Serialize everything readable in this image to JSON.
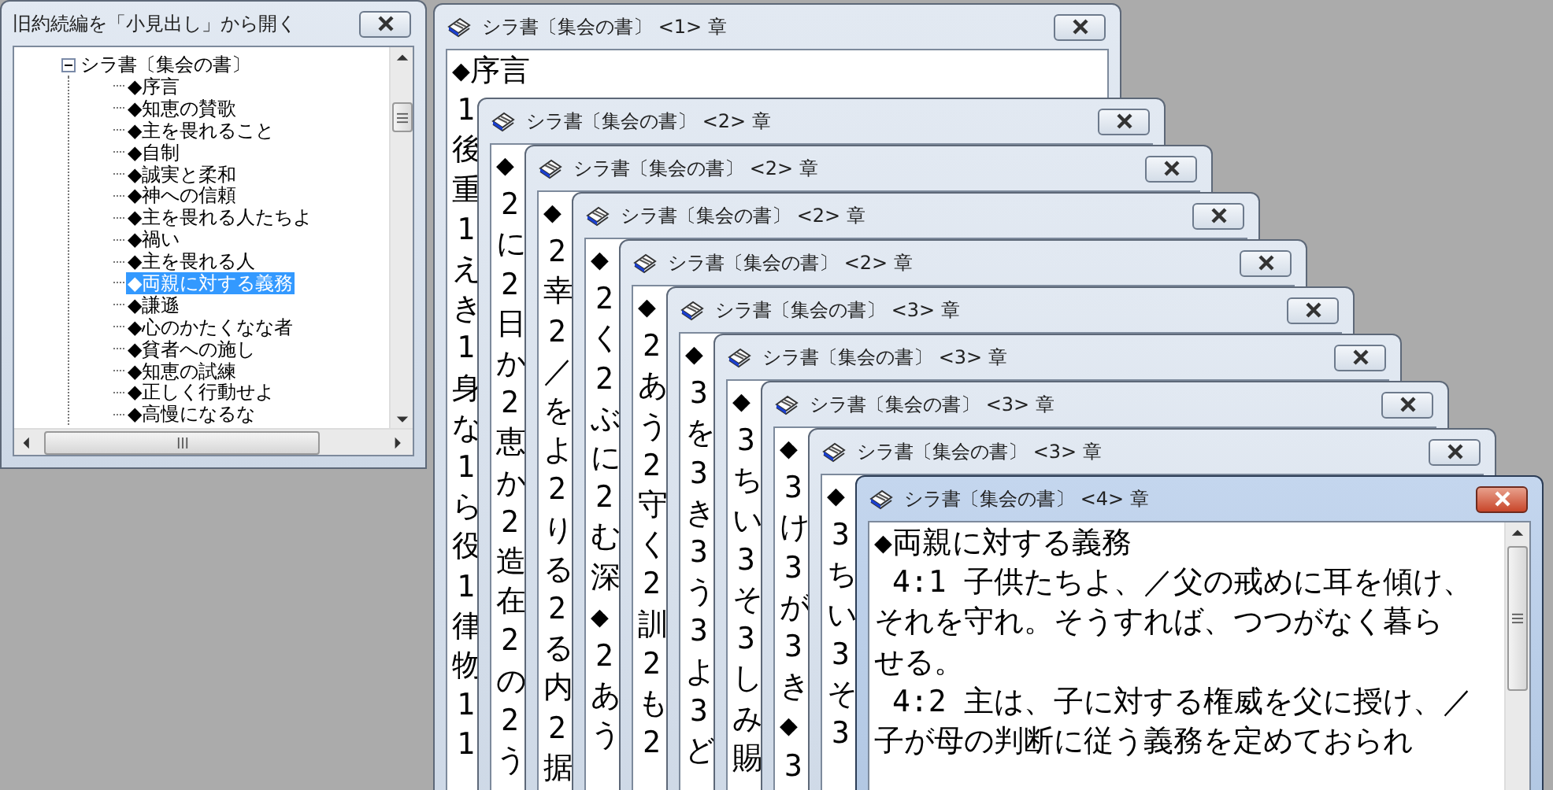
{
  "outline_window": {
    "title": "旧約続編を「小見出し」から開く",
    "active": false,
    "tree": [
      {
        "label": "シラ書〔集会の書〕",
        "expanded": true,
        "selected": false,
        "children": [
          {
            "label": "◆序言",
            "selected": false
          },
          {
            "label": "◆知恵の賛歌",
            "selected": false
          },
          {
            "label": "◆主を畏れること",
            "selected": false
          },
          {
            "label": "◆自制",
            "selected": false
          },
          {
            "label": "◆誠実と柔和",
            "selected": false
          },
          {
            "label": "◆神への信頼",
            "selected": false
          },
          {
            "label": "◆主を畏れる人たちよ",
            "selected": false
          },
          {
            "label": "◆禍い",
            "selected": false
          },
          {
            "label": "◆主を畏れる人",
            "selected": false
          },
          {
            "label": "◆両親に対する義務",
            "selected": true
          },
          {
            "label": "◆謙遜",
            "selected": false
          },
          {
            "label": "◆心のかたくなな者",
            "selected": false
          },
          {
            "label": "◆貧者への施し",
            "selected": false
          },
          {
            "label": "◆知恵の試練",
            "selected": false
          },
          {
            "label": "◆正しく行動せよ",
            "selected": false
          },
          {
            "label": "◆高慢になるな",
            "selected": false
          }
        ]
      }
    ]
  },
  "chapter_windows": [
    {
      "title": "シラ書〔集会の書〕 <1> 章",
      "active": false,
      "lines": [
        {
          "text": "◆序言",
          "kind": "heading"
        },
        {
          "text": "1",
          "kind": "number"
        },
        {
          "text": "後",
          "kind": "text"
        },
        {
          "text": "重",
          "kind": "text"
        },
        {
          "text": "1",
          "kind": "number"
        },
        {
          "text": "え",
          "kind": "text"
        },
        {
          "text": "き",
          "kind": "text"
        },
        {
          "text": "1",
          "kind": "number"
        },
        {
          "text": "身",
          "kind": "text"
        },
        {
          "text": "な",
          "kind": "text"
        },
        {
          "text": "1",
          "kind": "number"
        },
        {
          "text": "ら",
          "kind": "text"
        },
        {
          "text": "役",
          "kind": "text"
        },
        {
          "text": "1",
          "kind": "number"
        },
        {
          "text": "律",
          "kind": "text"
        },
        {
          "text": "物",
          "kind": "text"
        },
        {
          "text": "1",
          "kind": "number"
        },
        {
          "text": "1",
          "kind": "number"
        }
      ]
    },
    {
      "title": "シラ書〔集会の書〕 <2> 章",
      "active": false,
      "lines": [
        {
          "text": "◆",
          "kind": "heading"
        },
        {
          "text": "2",
          "kind": "number"
        },
        {
          "text": "に",
          "kind": "text"
        },
        {
          "text": "2",
          "kind": "number"
        },
        {
          "text": "日",
          "kind": "text"
        },
        {
          "text": "か",
          "kind": "text"
        },
        {
          "text": "2",
          "kind": "number"
        },
        {
          "text": "恵",
          "kind": "text"
        },
        {
          "text": "か",
          "kind": "text"
        },
        {
          "text": "2",
          "kind": "number"
        },
        {
          "text": "造",
          "kind": "text"
        },
        {
          "text": "在",
          "kind": "text"
        },
        {
          "text": "2",
          "kind": "number"
        },
        {
          "text": "の",
          "kind": "text"
        },
        {
          "text": "2",
          "kind": "number"
        },
        {
          "text": "う",
          "kind": "text"
        }
      ]
    },
    {
      "title": "シラ書〔集会の書〕 <2> 章",
      "active": false,
      "lines": [
        {
          "text": "◆",
          "kind": "heading"
        },
        {
          "text": "2",
          "kind": "number"
        },
        {
          "text": "幸",
          "kind": "text"
        },
        {
          "text": "2",
          "kind": "number"
        },
        {
          "text": "／",
          "kind": "text"
        },
        {
          "text": "を",
          "kind": "text"
        },
        {
          "text": "よ",
          "kind": "text"
        },
        {
          "text": "2",
          "kind": "number"
        },
        {
          "text": "り",
          "kind": "text"
        },
        {
          "text": "る",
          "kind": "text"
        },
        {
          "text": "2",
          "kind": "number"
        },
        {
          "text": "る",
          "kind": "text"
        },
        {
          "text": "内",
          "kind": "text"
        },
        {
          "text": "2",
          "kind": "number"
        },
        {
          "text": "据",
          "kind": "text"
        }
      ]
    },
    {
      "title": "シラ書〔集会の書〕 <2> 章",
      "active": false,
      "lines": [
        {
          "text": "◆",
          "kind": "heading"
        },
        {
          "text": "2",
          "kind": "number"
        },
        {
          "text": "く",
          "kind": "text"
        },
        {
          "text": "2",
          "kind": "number"
        },
        {
          "text": "ぶ",
          "kind": "text"
        },
        {
          "text": "に",
          "kind": "text"
        },
        {
          "text": "2",
          "kind": "number"
        },
        {
          "text": "む",
          "kind": "text"
        },
        {
          "text": "深",
          "kind": "text"
        },
        {
          "text": "◆",
          "kind": "heading"
        },
        {
          "text": "2",
          "kind": "number"
        },
        {
          "text": "あ",
          "kind": "text"
        },
        {
          "text": "う",
          "kind": "text"
        }
      ]
    },
    {
      "title": "シラ書〔集会の書〕 <2> 章",
      "active": false,
      "lines": [
        {
          "text": "◆",
          "kind": "heading"
        },
        {
          "text": "2",
          "kind": "number"
        },
        {
          "text": "あ",
          "kind": "text"
        },
        {
          "text": "う",
          "kind": "text"
        },
        {
          "text": "2",
          "kind": "number"
        },
        {
          "text": "守",
          "kind": "text"
        },
        {
          "text": "く",
          "kind": "text"
        },
        {
          "text": "2",
          "kind": "number"
        },
        {
          "text": "訓",
          "kind": "text"
        },
        {
          "text": "2",
          "kind": "number"
        },
        {
          "text": "も",
          "kind": "text"
        },
        {
          "text": "2",
          "kind": "number"
        }
      ]
    },
    {
      "title": "シラ書〔集会の書〕 <3> 章",
      "active": false,
      "lines": [
        {
          "text": "◆",
          "kind": "heading"
        },
        {
          "text": "3",
          "kind": "number"
        },
        {
          "text": "を",
          "kind": "text"
        },
        {
          "text": "3",
          "kind": "number"
        },
        {
          "text": "き",
          "kind": "text"
        },
        {
          "text": "3",
          "kind": "number"
        },
        {
          "text": "う",
          "kind": "text"
        },
        {
          "text": "3",
          "kind": "number"
        },
        {
          "text": "よ",
          "kind": "text"
        },
        {
          "text": "3",
          "kind": "number"
        },
        {
          "text": "ど",
          "kind": "text"
        }
      ]
    },
    {
      "title": "シラ書〔集会の書〕 <3> 章",
      "active": false,
      "lines": [
        {
          "text": "◆",
          "kind": "heading"
        },
        {
          "text": "3",
          "kind": "number"
        },
        {
          "text": "ち",
          "kind": "text"
        },
        {
          "text": "い",
          "kind": "text"
        },
        {
          "text": "3",
          "kind": "number"
        },
        {
          "text": "そ",
          "kind": "text"
        },
        {
          "text": "3",
          "kind": "number"
        },
        {
          "text": "し",
          "kind": "text"
        },
        {
          "text": "み",
          "kind": "text"
        },
        {
          "text": "賜",
          "kind": "text"
        }
      ]
    },
    {
      "title": "シラ書〔集会の書〕 <3> 章",
      "active": false,
      "lines": [
        {
          "text": "◆",
          "kind": "heading"
        },
        {
          "text": "3",
          "kind": "number"
        },
        {
          "text": "け",
          "kind": "text"
        },
        {
          "text": "3",
          "kind": "number"
        },
        {
          "text": "が",
          "kind": "text"
        },
        {
          "text": "3",
          "kind": "number"
        },
        {
          "text": "き",
          "kind": "text"
        },
        {
          "text": "◆",
          "kind": "heading"
        },
        {
          "text": "3",
          "kind": "number"
        }
      ]
    },
    {
      "title": "シラ書〔集会の書〕 <3> 章",
      "active": false,
      "lines": [
        {
          "text": "◆",
          "kind": "heading"
        },
        {
          "text": "3",
          "kind": "number"
        },
        {
          "text": "ち",
          "kind": "text"
        },
        {
          "text": "い",
          "kind": "text"
        },
        {
          "text": "3",
          "kind": "number"
        },
        {
          "text": "そ",
          "kind": "text"
        },
        {
          "text": "3",
          "kind": "number"
        }
      ]
    },
    {
      "title": "シラ書〔集会の書〕 <4> 章",
      "active": true,
      "lines": [
        {
          "text": "◆両親に対する義務",
          "kind": "heading"
        },
        {
          "text": " 4:1 子供たちよ、／父の戒めに耳を傾け、",
          "kind": "text"
        },
        {
          "text": "それを守れ。そうすれば、つつがなく暮ら",
          "kind": "text"
        },
        {
          "text": "せる。",
          "kind": "text"
        },
        {
          "text": " 4:2 主は、子に対する権威を父に授け、／",
          "kind": "text"
        },
        {
          "text": "子が母の判断に従う義務を定めておられ",
          "kind": "text"
        }
      ]
    }
  ]
}
